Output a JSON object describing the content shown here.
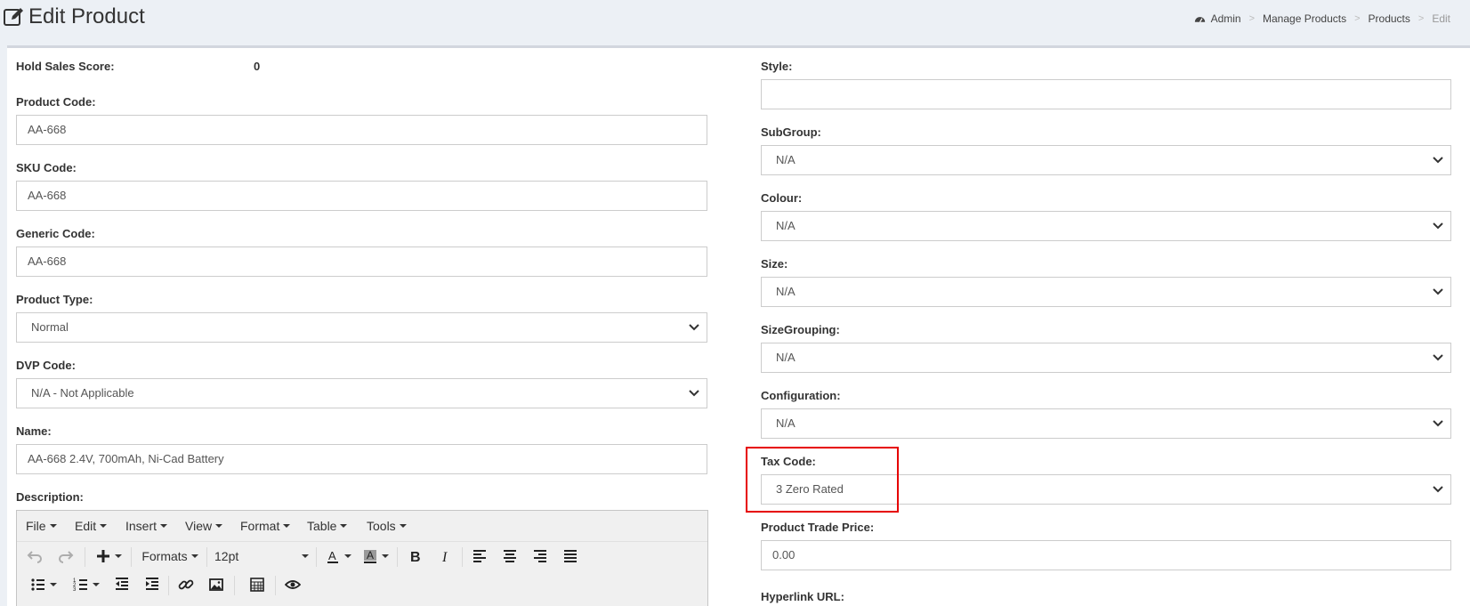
{
  "header": {
    "title": "Edit Product",
    "breadcrumb": [
      "Admin",
      "Manage Products",
      "Products",
      "Edit"
    ]
  },
  "left": {
    "hold_sales_score": {
      "label": "Hold Sales Score:",
      "value": "0"
    },
    "product_code": {
      "label": "Product Code:",
      "value": "AA-668"
    },
    "sku_code": {
      "label": "SKU Code:",
      "value": "AA-668"
    },
    "generic_code": {
      "label": "Generic Code:",
      "value": "AA-668"
    },
    "product_type": {
      "label": "Product Type:",
      "value": "Normal"
    },
    "dvp_code": {
      "label": "DVP Code:",
      "value": "N/A - Not Applicable"
    },
    "name": {
      "label": "Name:",
      "value": "AA-668 2.4V, 700mAh, Ni-Cad Battery"
    },
    "description": {
      "label": "Description:"
    }
  },
  "right": {
    "style": {
      "label": "Style:",
      "value": ""
    },
    "subgroup": {
      "label": "SubGroup:",
      "value": "N/A"
    },
    "colour": {
      "label": "Colour:",
      "value": "N/A"
    },
    "size": {
      "label": "Size:",
      "value": "N/A"
    },
    "size_grouping": {
      "label": "SizeGrouping:",
      "value": "N/A"
    },
    "configuration": {
      "label": "Configuration:",
      "value": "N/A"
    },
    "tax_code": {
      "label": "Tax Code:",
      "value": "3 Zero Rated"
    },
    "trade_price": {
      "label": "Product Trade Price:",
      "value": "0.00"
    },
    "hyperlink": {
      "label": "Hyperlink URL:"
    }
  },
  "editor": {
    "menus": [
      "File",
      "Edit",
      "Insert",
      "View",
      "Format",
      "Table",
      "Tools"
    ],
    "formats_label": "Formats",
    "font_size": "12pt",
    "icons": [
      "undo-icon",
      "redo-icon",
      "insert-plus-icon",
      "font-color-icon",
      "bg-color-icon",
      "bold-icon",
      "italic-icon",
      "align-left-icon",
      "align-center-icon",
      "align-right-icon",
      "justify-icon",
      "bullet-list-icon",
      "numbered-list-icon",
      "outdent-icon",
      "indent-icon",
      "link-icon",
      "image-icon",
      "table-grid-icon",
      "preview-icon"
    ]
  },
  "colors": {
    "background": "#ecf0f5",
    "highlight": "#e60000",
    "border": "#cccccc"
  }
}
